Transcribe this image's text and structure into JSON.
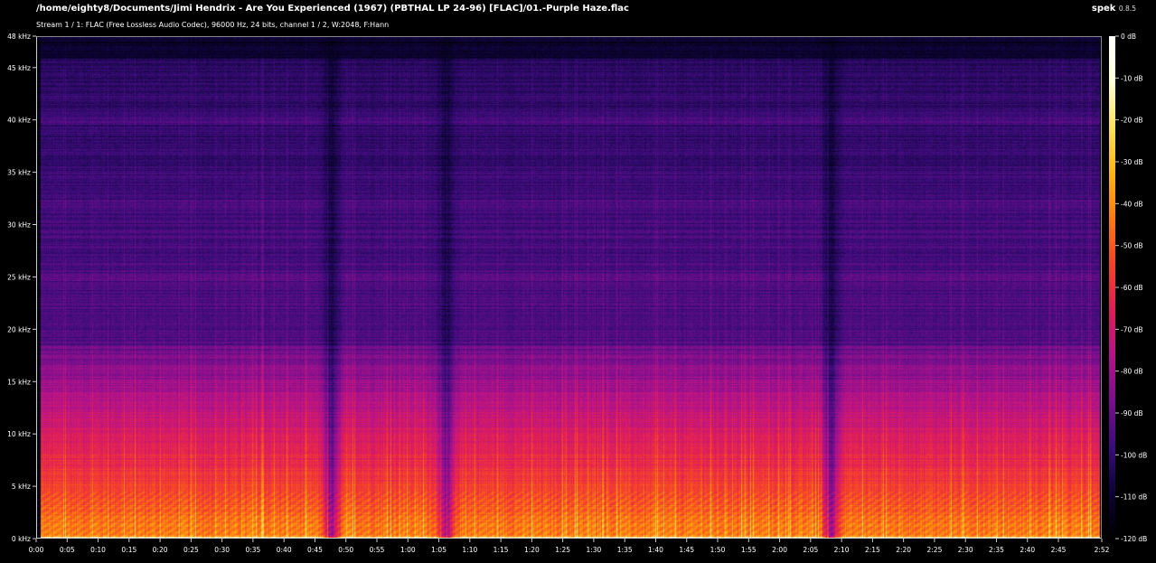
{
  "header": {
    "file_path": "/home/eighty8/Documents/Jimi Hendrix - Are You Experienced (1967) (PBTHAL LP 24-96) [FLAC]/01.-Purple Haze.flac",
    "stream_info": "Stream 1 / 1: FLAC (Free Lossless Audio Codec), 96000 Hz, 24 bits, channel 1 / 2, W:2048, F:Hann",
    "app_name": "spek",
    "app_version": "0.8.5"
  },
  "chart_data": {
    "type": "heatmap",
    "x_axis": {
      "unit": "seconds",
      "range": [
        0,
        172
      ],
      "tick_labels": [
        "0:00",
        "0:05",
        "0:10",
        "0:15",
        "0:20",
        "0:25",
        "0:30",
        "0:35",
        "0:40",
        "0:45",
        "0:50",
        "0:55",
        "1:00",
        "1:05",
        "1:10",
        "1:15",
        "1:20",
        "1:25",
        "1:30",
        "1:35",
        "1:40",
        "1:45",
        "1:50",
        "1:55",
        "2:00",
        "2:05",
        "2:10",
        "2:15",
        "2:20",
        "2:25",
        "2:30",
        "2:35",
        "2:40",
        "2:45",
        "2:52"
      ],
      "tick_values": [
        0,
        5,
        10,
        15,
        20,
        25,
        30,
        35,
        40,
        45,
        50,
        55,
        60,
        65,
        70,
        75,
        80,
        85,
        90,
        95,
        100,
        105,
        110,
        115,
        120,
        125,
        130,
        135,
        140,
        145,
        150,
        155,
        160,
        165,
        172
      ]
    },
    "y_axis": {
      "unit": "kHz",
      "range": [
        0,
        48
      ],
      "tick_labels": [
        "0 kHz",
        "5 kHz",
        "10 kHz",
        "15 kHz",
        "20 kHz",
        "25 kHz",
        "30 kHz",
        "35 kHz",
        "40 kHz",
        "45 kHz",
        "48 kHz"
      ],
      "tick_values": [
        0,
        5,
        10,
        15,
        20,
        25,
        30,
        35,
        40,
        45,
        48
      ]
    },
    "color_scale": {
      "unit": "dB",
      "range": [
        -120,
        0
      ],
      "tick_labels": [
        "0 dB",
        "-10 dB",
        "-20 dB",
        "-30 dB",
        "-40 dB",
        "-50 dB",
        "-60 dB",
        "-70 dB",
        "-80 dB",
        "-90 dB",
        "-100 dB",
        "-110 dB",
        "-120 dB"
      ],
      "tick_values": [
        0,
        -10,
        -20,
        -30,
        -40,
        -50,
        -60,
        -70,
        -80,
        -90,
        -100,
        -110,
        -120
      ],
      "colors": [
        "#000000",
        "#0d0437",
        "#3b0c7a",
        "#7a0f8c",
        "#b4138a",
        "#e01e5a",
        "#f5412a",
        "#fb7a12",
        "#fdb515",
        "#fde25a",
        "#ffffd8",
        "#ffffff"
      ]
    },
    "features": {
      "lowpass_cutoff_khz": 18.5,
      "rolloff_end_khz": 46,
      "faint_band_khz": [
        25,
        32,
        40
      ],
      "quiet_dips_seconds": [
        47.5,
        66,
        128
      ]
    }
  }
}
